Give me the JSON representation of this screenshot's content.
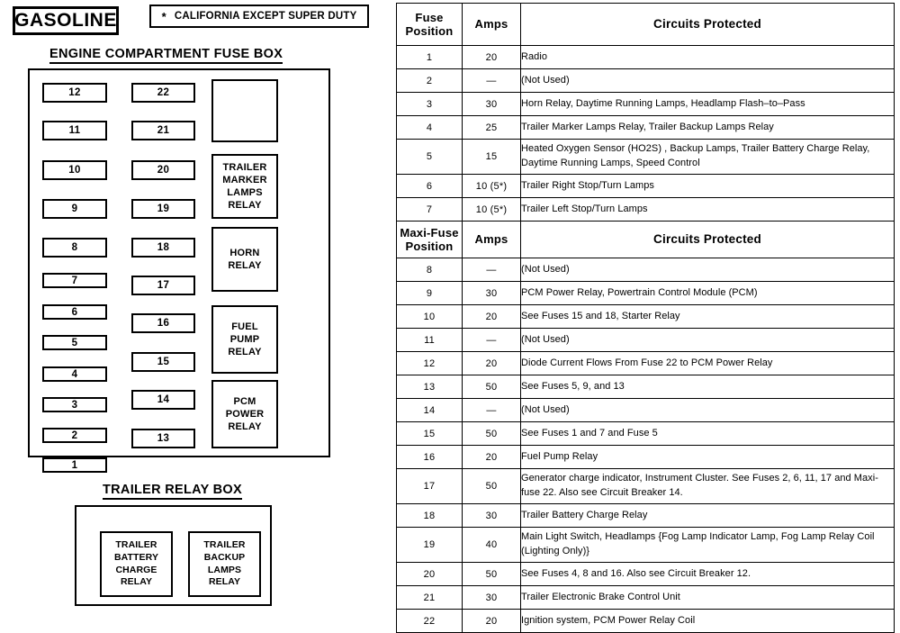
{
  "labels": {
    "gasoline": "GASOLINE",
    "california_note_star": "*",
    "california_note": "CALIFORNIA EXCEPT SUPER DUTY",
    "engine_heading": "ENGINE COMPARTMENT FUSE BOX",
    "trailer_heading": "TRAILER RELAY BOX"
  },
  "engine_fuse_box": {
    "left_column_slots": [
      "12",
      "11",
      "10",
      "9",
      "8",
      "7",
      "6",
      "5",
      "4",
      "3",
      "2",
      "1"
    ],
    "right_column_slots": [
      "22",
      "21",
      "20",
      "19",
      "18",
      "17",
      "16",
      "15",
      "14",
      "13"
    ],
    "relays": [
      {
        "lines": []
      },
      {
        "lines": [
          "TRAILER",
          "MARKER",
          "LAMPS",
          "RELAY"
        ]
      },
      {
        "lines": [
          "HORN",
          "RELAY"
        ]
      },
      {
        "lines": [
          "FUEL",
          "PUMP",
          "RELAY"
        ]
      },
      {
        "lines": [
          "PCM",
          "POWER",
          "RELAY"
        ]
      }
    ]
  },
  "trailer_relay_box": {
    "relays": [
      {
        "lines": [
          "TRAILER",
          "BATTERY",
          "CHARGE",
          "RELAY"
        ]
      },
      {
        "lines": [
          "TRAILER",
          "BACKUP",
          "LAMPS",
          "RELAY"
        ]
      }
    ]
  },
  "fuse_table": {
    "header_fuse": {
      "position": "Fuse\nPosition",
      "position_l1": "Fuse",
      "position_l2": "Position",
      "amps": "Amps",
      "circuits": "Circuits Protected"
    },
    "header_maxi": {
      "position_l1": "Maxi-Fuse",
      "position_l2": "Position",
      "amps": "Amps",
      "circuits": "Circuits Protected"
    },
    "fuse_rows": [
      {
        "position": "1",
        "amps": "20",
        "circuits": "Radio",
        "lines": 1
      },
      {
        "position": "2",
        "amps": "—",
        "circuits": "(Not Used)",
        "lines": 1
      },
      {
        "position": "3",
        "amps": "30",
        "circuits": "Horn Relay, Daytime Running Lamps, Headlamp Flash–to–Pass",
        "lines": 1
      },
      {
        "position": "4",
        "amps": "25",
        "circuits": "Trailer Marker Lamps Relay, Trailer Backup Lamps Relay",
        "lines": 1
      },
      {
        "position": "5",
        "amps": "15",
        "circuits": "Heated Oxygen Sensor (HO2S) , Backup Lamps, Trailer Battery Charge Relay, Daytime Running Lamps, Speed Control",
        "lines": 2
      },
      {
        "position": "6",
        "amps": "10  (5*)",
        "circuits": "Trailer Right Stop/Turn Lamps",
        "lines": 1
      },
      {
        "position": "7",
        "amps": "10 (5*)",
        "circuits": "Trailer Left Stop/Turn Lamps",
        "lines": 1
      }
    ],
    "maxi_rows": [
      {
        "position": "8",
        "amps": "—",
        "circuits": "(Not  Used)",
        "lines": 1
      },
      {
        "position": "9",
        "amps": "30",
        "circuits": "PCM Power Relay, Powertrain Control Module (PCM)",
        "lines": 1
      },
      {
        "position": "10",
        "amps": "20",
        "circuits": "See Fuses 15 and 18, Starter Relay",
        "lines": 1
      },
      {
        "position": "11",
        "amps": "—",
        "circuits": "(Not Used)",
        "lines": 1
      },
      {
        "position": "12",
        "amps": "20",
        "circuits": "Diode Current Flows From Fuse 22 to PCM Power Relay",
        "lines": 1
      },
      {
        "position": "13",
        "amps": "50",
        "circuits": "See Fuses 5, 9, and 13",
        "lines": 1
      },
      {
        "position": "14",
        "amps": "—",
        "circuits": "(Not  Used)",
        "lines": 1
      },
      {
        "position": "15",
        "amps": "50",
        "circuits": "See Fuses 1 and 7 and Fuse 5",
        "lines": 1
      },
      {
        "position": "16",
        "amps": "20",
        "circuits": "Fuel Pump Relay",
        "lines": 1
      },
      {
        "position": "17",
        "amps": "50",
        "circuits": "Generator charge indicator, Instrument Cluster.  See Fuses 2, 6, 11, 17 and Maxi-fuse 22.  Also see Circuit Breaker 14.",
        "lines": 2
      },
      {
        "position": "18",
        "amps": "30",
        "circuits": "Trailer Battery Charge Relay",
        "lines": 1
      },
      {
        "position": "19",
        "amps": "40",
        "circuits": "Main Light Switch, Headlamps {Fog Lamp Indicator Lamp, Fog Lamp Relay Coil (Lighting Only)}",
        "lines": 2
      },
      {
        "position": "20",
        "amps": "50",
        "circuits": "See Fuses 4, 8 and 16. Also see Circuit Breaker 12.",
        "lines": 1
      },
      {
        "position": "21",
        "amps": "30",
        "circuits": "Trailer Electronic Brake Control Unit",
        "lines": 1
      },
      {
        "position": "22",
        "amps": "20",
        "circuits": "Ignition system, PCM Power Relay Coil",
        "lines": 1
      }
    ]
  },
  "colors": {
    "ink": "#000000",
    "paper": "#ffffff"
  }
}
